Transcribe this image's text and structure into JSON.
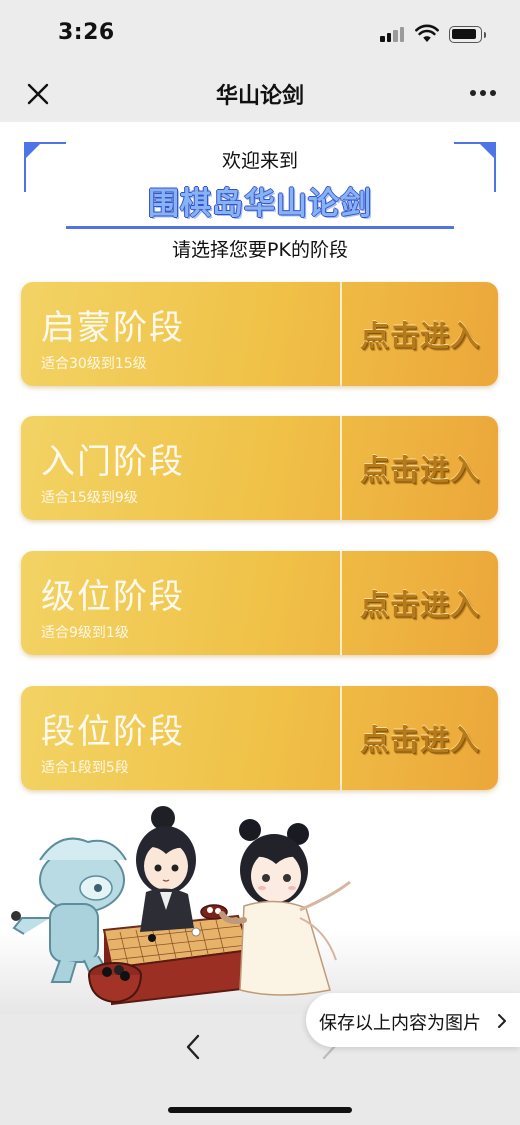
{
  "status_bar": {
    "time": "3:26"
  },
  "nav": {
    "title": "华山论剑"
  },
  "header": {
    "welcome": "欢迎来到",
    "title": "围棋岛华山论剑",
    "subtitle": "请选择您要PK的阶段"
  },
  "stages": [
    {
      "name": "启蒙阶段",
      "range": "适合30级到15级",
      "action": "点击进入"
    },
    {
      "name": "入门阶段",
      "range": "适合15级到9级",
      "action": "点击进入"
    },
    {
      "name": "级位阶段",
      "range": "适合9级到1级",
      "action": "点击进入"
    },
    {
      "name": "段位阶段",
      "range": "适合1段到5段",
      "action": "点击进入"
    }
  ],
  "save_image": {
    "label": "保存以上内容为图片"
  },
  "colors": {
    "accent_blue": "#4e74e8",
    "card_gold_light": "#f2d364",
    "card_gold_dark": "#eca73a",
    "enter_text": "#b77a18"
  },
  "icons": [
    "close-icon",
    "more-icon",
    "signal-icon",
    "wifi-icon",
    "battery-icon",
    "back-arrow-icon",
    "forward-arrow-icon",
    "chevron-right-icon"
  ]
}
